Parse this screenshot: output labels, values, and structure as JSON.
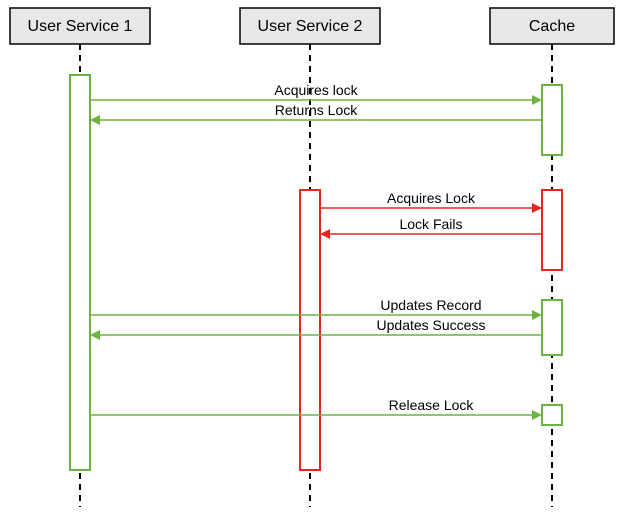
{
  "participants": {
    "p1": "User Service 1",
    "p2": "User Service 2",
    "p3": "Cache"
  },
  "messages": {
    "m1": "Acquires lock",
    "m2": "Returns Lock",
    "m3": "Acquires Lock",
    "m4": "Lock Fails",
    "m5": "Updates Record",
    "m6": "Updates Success",
    "m7": "Release Lock"
  },
  "chart_data": {
    "type": "sequence-diagram",
    "participants": [
      "User Service 1",
      "User Service 2",
      "Cache"
    ],
    "activations": [
      {
        "participant": "User Service 1",
        "from_step": 1,
        "to_step": 8,
        "color": "green"
      },
      {
        "participant": "Cache",
        "from_step": 1,
        "to_step": 2,
        "color": "green"
      },
      {
        "participant": "User Service 2",
        "from_step": 3,
        "to_step": 8,
        "color": "red"
      },
      {
        "participant": "Cache",
        "from_step": 3,
        "to_step": 4,
        "color": "red"
      },
      {
        "participant": "Cache",
        "from_step": 5,
        "to_step": 6,
        "color": "green"
      },
      {
        "participant": "Cache",
        "from_step": 7,
        "to_step": 7,
        "color": "green"
      }
    ],
    "messages": [
      {
        "step": 1,
        "from": "User Service 1",
        "to": "Cache",
        "label": "Acquires lock",
        "color": "green"
      },
      {
        "step": 2,
        "from": "Cache",
        "to": "User Service 1",
        "label": "Returns Lock",
        "color": "green"
      },
      {
        "step": 3,
        "from": "User Service 2",
        "to": "Cache",
        "label": "Acquires Lock",
        "color": "red"
      },
      {
        "step": 4,
        "from": "Cache",
        "to": "User Service 2",
        "label": "Lock Fails",
        "color": "red"
      },
      {
        "step": 5,
        "from": "User Service 1",
        "to": "Cache",
        "label": "Updates Record",
        "color": "green"
      },
      {
        "step": 6,
        "from": "Cache",
        "to": "User Service 1",
        "label": "Updates Success",
        "color": "green"
      },
      {
        "step": 7,
        "from": "User Service 1",
        "to": "Cache",
        "label": "Release Lock",
        "color": "green"
      }
    ]
  }
}
